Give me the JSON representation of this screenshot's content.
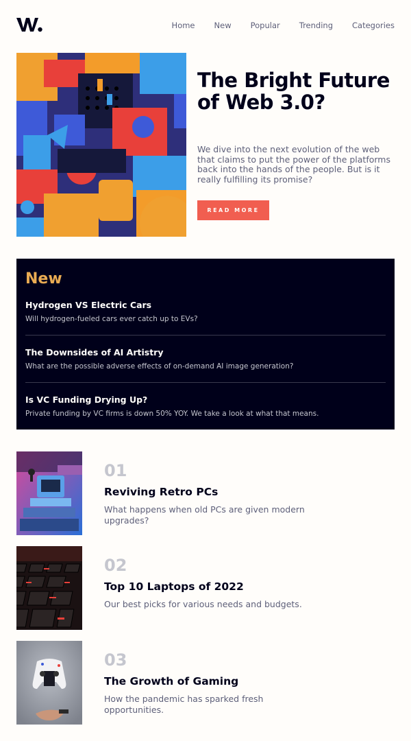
{
  "brand": {
    "logo_text": "W."
  },
  "nav": {
    "items": [
      "Home",
      "New",
      "Popular",
      "Trending",
      "Categories"
    ]
  },
  "hero": {
    "image_icon": "abstract-3d-blocks-image",
    "title": "The Bright Future of Web 3.0?",
    "description": "We dive into the next evolution of the web that claims to put the power of the platforms back into the hands of the people. But is it really fulfilling its promise?",
    "button_label": "READ MORE"
  },
  "new_section": {
    "heading": "New",
    "items": [
      {
        "title": "Hydrogen VS Electric Cars",
        "description": "Will hydrogen-fueled cars ever catch up to EVs?"
      },
      {
        "title": "The Downsides of AI Artistry",
        "description": "What are the possible adverse effects of on-demand AI image generation?"
      },
      {
        "title": "Is VC Funding Drying Up?",
        "description": "Private funding by VC firms is down 50% YOY. We take a look at what that means."
      }
    ]
  },
  "list": {
    "items": [
      {
        "number": "01",
        "title": "Reviving Retro PCs",
        "description": "What happens when old PCs are given modern upgrades?",
        "image_icon": "retro-pc-image"
      },
      {
        "number": "02",
        "title": "Top 10 Laptops of 2022",
        "description": "Our best picks for various needs and budgets.",
        "image_icon": "laptop-keyboard-image"
      },
      {
        "number": "03",
        "title": "The Growth of Gaming",
        "description": "How the pandemic has sparked fresh opportunities.",
        "image_icon": "game-controller-image"
      }
    ]
  },
  "colors": {
    "background": "#fffdfa",
    "dark": "#00001a",
    "accent_red": "#f15e50",
    "accent_orange": "#e9ab53",
    "muted": "#5d5f79",
    "light_grey": "#c5c6ce"
  }
}
